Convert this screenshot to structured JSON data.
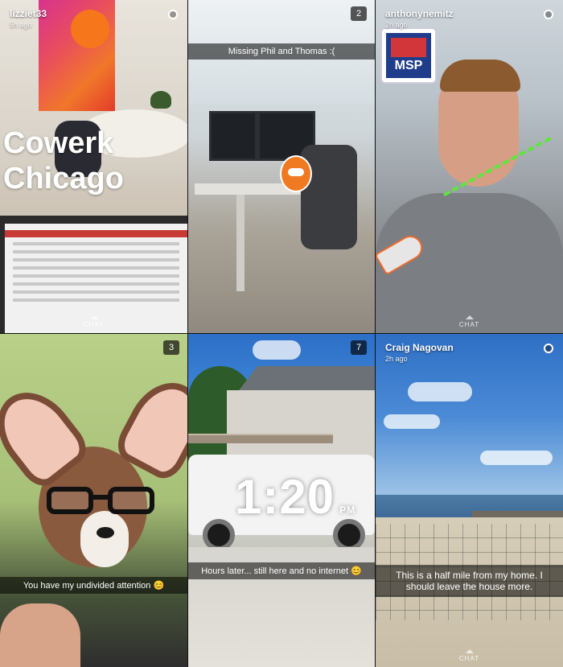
{
  "stories": [
    {
      "username": "lizziet33",
      "time_ago": "5h ago",
      "caption_large_line1": "Cowerk",
      "caption_large_line2": "Chicago",
      "chat_label": "CHAT"
    },
    {
      "count": "2",
      "caption": "Missing Phil and Thomas :("
    },
    {
      "username": "anthonynemitz",
      "time_ago": "2h ago",
      "sticker_label": "MSP",
      "chat_label": "CHAT"
    },
    {
      "count": "3",
      "caption": "You have my undivided attention 😊"
    },
    {
      "count": "7",
      "clock_time": "1:20",
      "clock_suffix": "PM",
      "caption": "Hours later... still here and no internet 😊"
    },
    {
      "username": "Craig Nagovan",
      "time_ago": "2h ago",
      "caption": "This is a half mile from my home. I should leave the house more.",
      "chat_label": "CHAT"
    }
  ]
}
